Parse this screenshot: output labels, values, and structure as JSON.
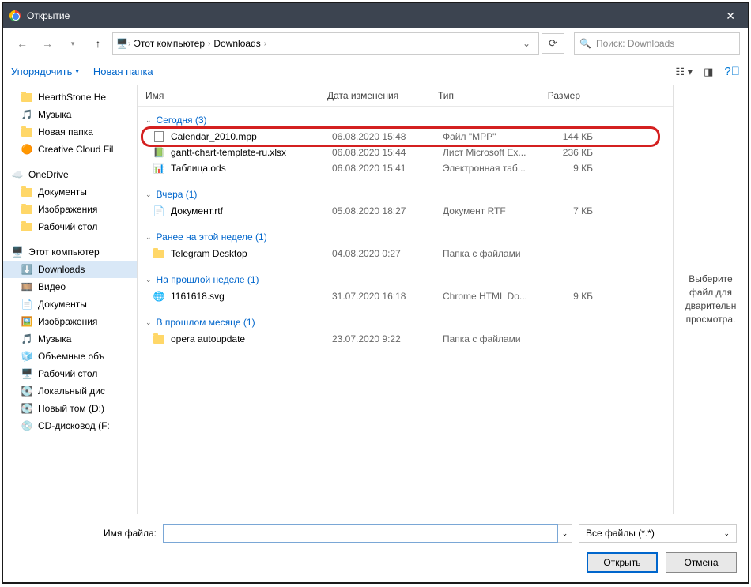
{
  "window": {
    "title": "Открытие"
  },
  "nav": {
    "breadcrumb": [
      "Этот компьютер",
      "Downloads"
    ],
    "search_placeholder": "Поиск: Downloads"
  },
  "toolbar": {
    "organize": "Упорядочить",
    "new_folder": "Новая папка"
  },
  "sidebar": {
    "items": [
      {
        "label": "HearthStone  He",
        "icon": "folder",
        "root": false
      },
      {
        "label": "Музыка",
        "icon": "music",
        "root": false
      },
      {
        "label": "Новая папка",
        "icon": "folder",
        "root": false
      },
      {
        "label": "Creative Cloud Fil",
        "icon": "cc",
        "root": false
      },
      {
        "sep": true
      },
      {
        "label": "OneDrive",
        "icon": "onedrive",
        "root": true
      },
      {
        "label": "Документы",
        "icon": "folder",
        "root": false
      },
      {
        "label": "Изображения",
        "icon": "folder",
        "root": false
      },
      {
        "label": "Рабочий стол",
        "icon": "folder",
        "root": false
      },
      {
        "sep": true
      },
      {
        "label": "Этот компьютер",
        "icon": "pc",
        "root": true
      },
      {
        "label": "Downloads",
        "icon": "downloads",
        "root": false,
        "selected": true
      },
      {
        "label": "Видео",
        "icon": "video",
        "root": false
      },
      {
        "label": "Документы",
        "icon": "docs",
        "root": false
      },
      {
        "label": "Изображения",
        "icon": "images",
        "root": false
      },
      {
        "label": "Музыка",
        "icon": "music2",
        "root": false
      },
      {
        "label": "Объемные объ",
        "icon": "3d",
        "root": false
      },
      {
        "label": "Рабочий стол",
        "icon": "desktop",
        "root": false
      },
      {
        "label": "Локальный дис",
        "icon": "drive",
        "root": false
      },
      {
        "label": "Новый том (D:)",
        "icon": "drive",
        "root": false
      },
      {
        "label": "CD-дисковод (F:",
        "icon": "cd",
        "root": false
      }
    ]
  },
  "columns": {
    "name": "Имя",
    "date": "Дата изменения",
    "type": "Тип",
    "size": "Размер"
  },
  "groups": [
    {
      "title": "Сегодня (3)",
      "rows": [
        {
          "name": "Calendar_2010.mpp",
          "date": "06.08.2020 15:48",
          "type": "Файл \"MPP\"",
          "size": "144 КБ",
          "icon": "file",
          "highlight": true
        },
        {
          "name": "gantt-chart-template-ru.xlsx",
          "date": "06.08.2020 15:44",
          "type": "Лист Microsoft Ex...",
          "size": "236 КБ",
          "icon": "xlsx"
        },
        {
          "name": "Таблица.ods",
          "date": "06.08.2020 15:41",
          "type": "Электронная таб...",
          "size": "9 КБ",
          "icon": "ods"
        }
      ]
    },
    {
      "title": "Вчера (1)",
      "rows": [
        {
          "name": "Документ.rtf",
          "date": "05.08.2020 18:27",
          "type": "Документ RTF",
          "size": "7 КБ",
          "icon": "rtf"
        }
      ]
    },
    {
      "title": "Ранее на этой неделе (1)",
      "rows": [
        {
          "name": "Telegram Desktop",
          "date": "04.08.2020 0:27",
          "type": "Папка с файлами",
          "size": "",
          "icon": "folder"
        }
      ]
    },
    {
      "title": "На прошлой неделе (1)",
      "rows": [
        {
          "name": "1161618.svg",
          "date": "31.07.2020 16:18",
          "type": "Chrome HTML Do...",
          "size": "9 КБ",
          "icon": "chrome"
        }
      ]
    },
    {
      "title": "В прошлом месяце (1)",
      "rows": [
        {
          "name": "opera autoupdate",
          "date": "23.07.2020 9:22",
          "type": "Папка с файлами",
          "size": "",
          "icon": "folder"
        }
      ]
    }
  ],
  "preview": {
    "text": "Выберите файл для дварительн просмотра."
  },
  "footer": {
    "filename_label": "Имя файла:",
    "filename_value": "",
    "filter": "Все файлы (*.*)",
    "open": "Открыть",
    "cancel": "Отмена"
  }
}
